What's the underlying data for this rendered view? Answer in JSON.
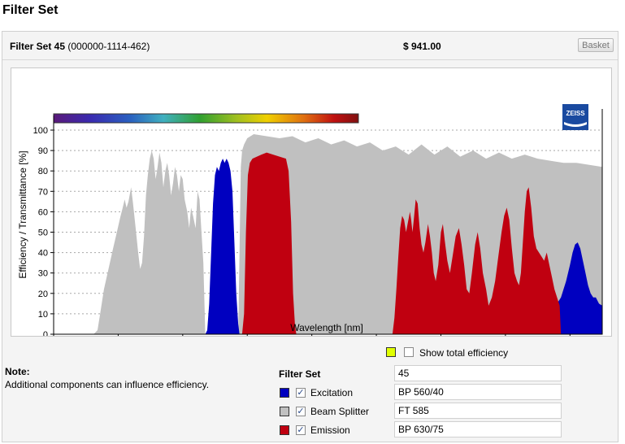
{
  "page": {
    "title": "Filter Set"
  },
  "header": {
    "name_bold": "Filter Set 45",
    "part_number": "(000000-1114-462)",
    "price": "$ 941.00",
    "basket_label": "Basket"
  },
  "brand": {
    "logo_text": "ZEISS"
  },
  "colors": {
    "excitation": "#0000c0",
    "beam_splitter": "#c0c0c0",
    "emission": "#c00010",
    "total_efficiency": "#e0ff00"
  },
  "chart_data": {
    "type": "area",
    "xlabel": "Wavelength [nm]",
    "ylabel": "Efficiency / Transmittance [%]",
    "xlim": [
      300,
      1150
    ],
    "ylim": [
      0,
      100
    ],
    "x_ticks": [
      300,
      400,
      500,
      600,
      700,
      800,
      900,
      1000,
      1100
    ],
    "y_ticks": [
      0,
      10,
      20,
      30,
      40,
      50,
      60,
      70,
      80,
      90,
      100
    ],
    "grid": "horizontal-dotted",
    "spectrum_bar": "visible spectrum 300-770 nm",
    "series": [
      {
        "name": "Beam Splitter",
        "color": "#c0c0c0",
        "points": [
          [
            350,
            0
          ],
          [
            362,
            0
          ],
          [
            368,
            2
          ],
          [
            373,
            12
          ],
          [
            378,
            22
          ],
          [
            385,
            32
          ],
          [
            392,
            42
          ],
          [
            398,
            50
          ],
          [
            403,
            57
          ],
          [
            407,
            62
          ],
          [
            410,
            66
          ],
          [
            413,
            62
          ],
          [
            416,
            65
          ],
          [
            420,
            72
          ],
          [
            423,
            64
          ],
          [
            427,
            52
          ],
          [
            431,
            40
          ],
          [
            434,
            32
          ],
          [
            437,
            35
          ],
          [
            440,
            48
          ],
          [
            443,
            68
          ],
          [
            446,
            78
          ],
          [
            449,
            86
          ],
          [
            452,
            90
          ],
          [
            455,
            86
          ],
          [
            458,
            76
          ],
          [
            461,
            82
          ],
          [
            464,
            89
          ],
          [
            467,
            84
          ],
          [
            470,
            72
          ],
          [
            473,
            80
          ],
          [
            476,
            84
          ],
          [
            479,
            78
          ],
          [
            482,
            68
          ],
          [
            485,
            74
          ],
          [
            488,
            82
          ],
          [
            491,
            78
          ],
          [
            494,
            70
          ],
          [
            497,
            78
          ],
          [
            500,
            76
          ],
          [
            503,
            66
          ],
          [
            507,
            60
          ],
          [
            510,
            52
          ],
          [
            513,
            62
          ],
          [
            516,
            58
          ],
          [
            520,
            52
          ],
          [
            523,
            70
          ],
          [
            526,
            66
          ],
          [
            529,
            50
          ],
          [
            532,
            35
          ],
          [
            535,
            0
          ],
          [
            586,
            0
          ],
          [
            588,
            40
          ],
          [
            590,
            82
          ],
          [
            592,
            90
          ],
          [
            595,
            93
          ],
          [
            600,
            96
          ],
          [
            610,
            98
          ],
          [
            630,
            97
          ],
          [
            650,
            96
          ],
          [
            670,
            97
          ],
          [
            690,
            94
          ],
          [
            710,
            96
          ],
          [
            730,
            93
          ],
          [
            750,
            95
          ],
          [
            770,
            92
          ],
          [
            790,
            94
          ],
          [
            810,
            90
          ],
          [
            830,
            92
          ],
          [
            850,
            88
          ],
          [
            870,
            93
          ],
          [
            890,
            88
          ],
          [
            910,
            92
          ],
          [
            930,
            87
          ],
          [
            950,
            90
          ],
          [
            970,
            86
          ],
          [
            990,
            89
          ],
          [
            1010,
            86
          ],
          [
            1030,
            88
          ],
          [
            1050,
            86
          ],
          [
            1070,
            85
          ],
          [
            1090,
            84
          ],
          [
            1110,
            84
          ],
          [
            1130,
            83
          ],
          [
            1150,
            82
          ],
          [
            1150,
            0
          ]
        ]
      },
      {
        "name": "Excitation",
        "color": "#0000c0",
        "points": [
          [
            535,
            0
          ],
          [
            538,
            2
          ],
          [
            541,
            15
          ],
          [
            544,
            40
          ],
          [
            547,
            64
          ],
          [
            550,
            78
          ],
          [
            553,
            82
          ],
          [
            556,
            80
          ],
          [
            559,
            84
          ],
          [
            562,
            86
          ],
          [
            565,
            84
          ],
          [
            568,
            86
          ],
          [
            571,
            84
          ],
          [
            574,
            80
          ],
          [
            577,
            70
          ],
          [
            580,
            45
          ],
          [
            583,
            20
          ],
          [
            586,
            5
          ],
          [
            588,
            0
          ],
          [
            1010,
            0
          ],
          [
            1016,
            8
          ],
          [
            1020,
            18
          ],
          [
            1023,
            24
          ],
          [
            1027,
            20
          ],
          [
            1031,
            16
          ],
          [
            1036,
            18
          ],
          [
            1041,
            22
          ],
          [
            1046,
            28
          ],
          [
            1050,
            30
          ],
          [
            1054,
            32
          ],
          [
            1058,
            26
          ],
          [
            1062,
            18
          ],
          [
            1066,
            14
          ],
          [
            1070,
            12
          ],
          [
            1078,
            14
          ],
          [
            1086,
            18
          ],
          [
            1094,
            26
          ],
          [
            1100,
            34
          ],
          [
            1104,
            40
          ],
          [
            1108,
            44
          ],
          [
            1112,
            45
          ],
          [
            1116,
            42
          ],
          [
            1120,
            36
          ],
          [
            1124,
            30
          ],
          [
            1128,
            24
          ],
          [
            1132,
            20
          ],
          [
            1136,
            18
          ],
          [
            1140,
            18
          ],
          [
            1145,
            15
          ],
          [
            1150,
            14
          ],
          [
            1150,
            0
          ]
        ]
      },
      {
        "name": "Emission",
        "color": "#c00010",
        "points": [
          [
            592,
            0
          ],
          [
            595,
            10
          ],
          [
            598,
            50
          ],
          [
            601,
            78
          ],
          [
            604,
            84
          ],
          [
            608,
            86
          ],
          [
            615,
            87
          ],
          [
            622,
            88
          ],
          [
            630,
            89
          ],
          [
            640,
            88
          ],
          [
            650,
            87
          ],
          [
            660,
            86
          ],
          [
            664,
            80
          ],
          [
            668,
            55
          ],
          [
            671,
            20
          ],
          [
            674,
            4
          ],
          [
            676,
            0
          ],
          [
            825,
            0
          ],
          [
            828,
            8
          ],
          [
            831,
            22
          ],
          [
            834,
            38
          ],
          [
            837,
            52
          ],
          [
            840,
            58
          ],
          [
            843,
            56
          ],
          [
            846,
            50
          ],
          [
            849,
            55
          ],
          [
            852,
            60
          ],
          [
            854,
            56
          ],
          [
            856,
            50
          ],
          [
            858,
            56
          ],
          [
            861,
            66
          ],
          [
            864,
            64
          ],
          [
            867,
            52
          ],
          [
            870,
            44
          ],
          [
            873,
            40
          ],
          [
            876,
            45
          ],
          [
            880,
            54
          ],
          [
            883,
            48
          ],
          [
            886,
            40
          ],
          [
            889,
            30
          ],
          [
            892,
            26
          ],
          [
            896,
            34
          ],
          [
            900,
            50
          ],
          [
            903,
            54
          ],
          [
            906,
            46
          ],
          [
            910,
            36
          ],
          [
            914,
            30
          ],
          [
            918,
            38
          ],
          [
            923,
            48
          ],
          [
            928,
            52
          ],
          [
            932,
            44
          ],
          [
            936,
            34
          ],
          [
            940,
            22
          ],
          [
            944,
            20
          ],
          [
            948,
            30
          ],
          [
            953,
            44
          ],
          [
            957,
            50
          ],
          [
            961,
            42
          ],
          [
            965,
            30
          ],
          [
            970,
            22
          ],
          [
            974,
            14
          ],
          [
            979,
            18
          ],
          [
            984,
            26
          ],
          [
            989,
            38
          ],
          [
            994,
            50
          ],
          [
            998,
            58
          ],
          [
            1002,
            62
          ],
          [
            1006,
            56
          ],
          [
            1010,
            42
          ],
          [
            1014,
            30
          ],
          [
            1018,
            26
          ],
          [
            1021,
            24
          ],
          [
            1024,
            30
          ],
          [
            1027,
            45
          ],
          [
            1030,
            60
          ],
          [
            1033,
            70
          ],
          [
            1036,
            72
          ],
          [
            1040,
            62
          ],
          [
            1044,
            48
          ],
          [
            1048,
            42
          ],
          [
            1052,
            40
          ],
          [
            1056,
            38
          ],
          [
            1060,
            36
          ],
          [
            1064,
            40
          ],
          [
            1068,
            34
          ],
          [
            1072,
            28
          ],
          [
            1076,
            22
          ],
          [
            1080,
            18
          ],
          [
            1084,
            14
          ],
          [
            1086,
            0
          ]
        ]
      }
    ]
  },
  "legend": {
    "show_total_label": "Show total efficiency",
    "filter_set_label": "Filter Set",
    "filter_set_value": "45",
    "rows": [
      {
        "label": "Excitation",
        "value": "BP 560/40",
        "check": "✓"
      },
      {
        "label": "Beam Splitter",
        "value": "FT 585",
        "check": "✓"
      },
      {
        "label": "Emission",
        "value": "BP 630/75",
        "check": "✓"
      }
    ]
  },
  "note": {
    "title": "Note:",
    "text": "Additional components can influence efficiency."
  }
}
